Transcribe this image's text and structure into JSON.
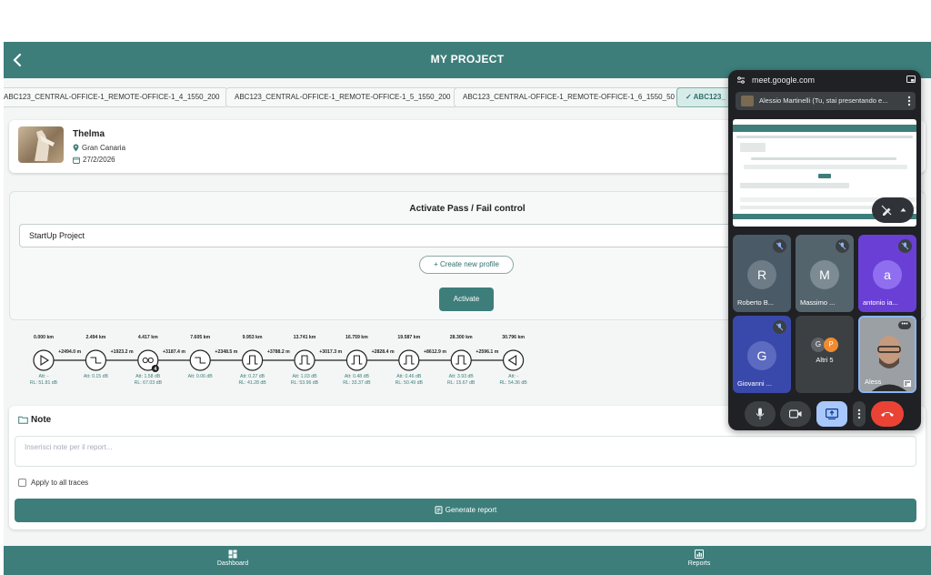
{
  "header": {
    "title": "MY PROJECT"
  },
  "tabs": [
    {
      "label": "ABC123_CENTRAL-OFFICE-1_REMOTE-OFFICE-1_4_1550_200"
    },
    {
      "label": "ABC123_CENTRAL-OFFICE-1_REMOTE-OFFICE-1_5_1550_200"
    },
    {
      "label": "ABC123_CENTRAL-OFFICE-1_REMOTE-OFFICE-1_6_1550_50"
    },
    {
      "label": "ABC123_",
      "active": true
    }
  ],
  "user": {
    "name": "Thelma",
    "location": "Gran Canaria",
    "date": "27/2/2026"
  },
  "passfail": {
    "title": "Activate Pass / Fail control",
    "profile": "StartUp Project",
    "create_label": "Create new profile",
    "activate_label": "Activate"
  },
  "trace": {
    "events": [
      {
        "km": "0.000 km",
        "type": "start",
        "att": "Att: -",
        "rl": "RL: 51.81 dB"
      },
      {
        "km": "2.494 km",
        "type": "step",
        "att": "Att: 0.15 dB",
        "rl": ""
      },
      {
        "km": "4.417 km",
        "type": "splitter",
        "badge": "4",
        "att": "Att: 1.58 dB",
        "rl": "RL: 67.03 dB"
      },
      {
        "km": "7.605 km",
        "type": "step",
        "att": "Att: 0.06 dB",
        "rl": ""
      },
      {
        "km": "9.953 km",
        "type": "reflect",
        "att": "Att: 0.27 dB",
        "rl": "RL: 41.28 dB"
      },
      {
        "km": "13.741 km",
        "type": "reflect",
        "att": "Att: 1.03 dB",
        "rl": "RL: 53.96 dB"
      },
      {
        "km": "16.759 km",
        "type": "reflect",
        "att": "Att: 0.48 dB",
        "rl": "RL: 33.37 dB"
      },
      {
        "km": "19.587 km",
        "type": "reflect",
        "att": "Att: 0.46 dB",
        "rl": "RL: 50.49 dB"
      },
      {
        "km": "28.300 km",
        "type": "reflect",
        "att": "Att: 3.93 dB",
        "rl": "RL: 15.67 dB"
      },
      {
        "km": "30.796 km",
        "type": "end",
        "att": "Att: -",
        "rl": "RL: 54.36 dB"
      }
    ],
    "spans": [
      "+2494.0 m",
      "+1923.2 m",
      "+3187.4 m",
      "+2348.5 m",
      "+3788.2 m",
      "+3017.3 m",
      "+2828.4 m",
      "+8612.9 m",
      "+2596.1 m"
    ]
  },
  "note": {
    "title": "Note",
    "placeholder": "Inserisci note per il report...",
    "apply_label": "Apply to all traces",
    "report_label": "Generate report"
  },
  "bottom_nav": [
    {
      "label": "Dashboard",
      "icon": "dashboard-icon"
    },
    {
      "label": "Reports",
      "icon": "reports-icon"
    }
  ],
  "meet": {
    "url": "meet.google.com",
    "presenting": "Alessio Martinelli (Tu, stai presentando e...",
    "participants": [
      {
        "initial": "R",
        "name": "Roberto B...",
        "color": "#5f6e7b"
      },
      {
        "initial": "M",
        "name": "Massimo ...",
        "color": "#6f7f89"
      },
      {
        "initial": "a",
        "name": "antonio ia...",
        "color": "#7c4dff"
      },
      {
        "initial": "G",
        "name": "Giovanni ...",
        "color": "#3f51b5"
      },
      {
        "initial": "",
        "name": "Altri 5",
        "color": "#3c4043"
      },
      {
        "initial": "",
        "name": "Aless",
        "color": "#8a8f93"
      }
    ]
  },
  "colors": {
    "primary": "#3d7e7b",
    "meet_bg": "#202124",
    "end_call": "#ea4335"
  }
}
